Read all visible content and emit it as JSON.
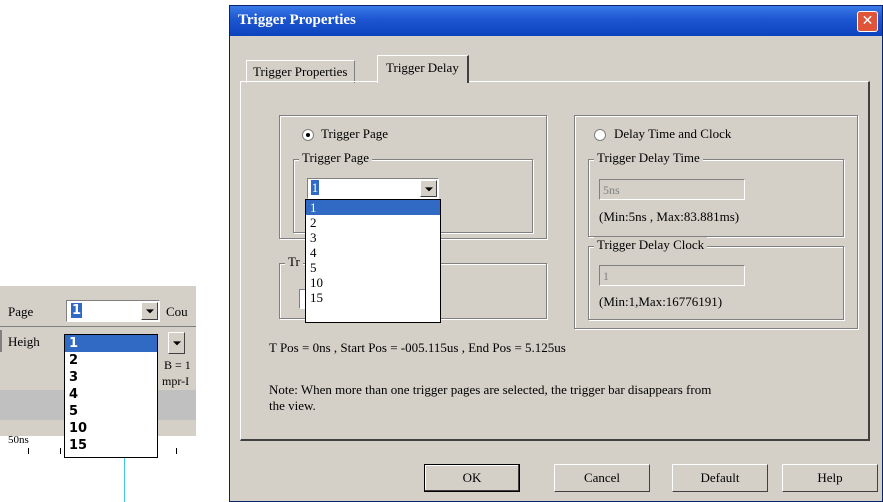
{
  "background_toolbar": {
    "page_label": "Page",
    "page_value": "1",
    "count_label": "Cou",
    "height_label": "Heigh",
    "b_text": "B = 1",
    "mpr_text": "mpr-I",
    "ruler_label": "50ns",
    "options": [
      "1",
      "2",
      "3",
      "4",
      "5",
      "10",
      "15"
    ],
    "selected": "1"
  },
  "dialog": {
    "title": "Trigger Properties",
    "close_symbol": "✕",
    "tabs": [
      {
        "label": "Trigger Properties",
        "active": false
      },
      {
        "label": "Trigger Delay",
        "active": true
      }
    ],
    "trigger_page_radio": {
      "label": "Trigger Page",
      "checked": true
    },
    "trigger_page_group": {
      "title": "Trigger Page",
      "selected_value": "1",
      "options": [
        "1",
        "2",
        "3",
        "4",
        "5",
        "10",
        "15"
      ]
    },
    "hidden_group_title_fragment": "Tr",
    "delay_radio": {
      "label": "Delay Time and Clock",
      "checked": false
    },
    "delay_time_group": {
      "title": "Trigger Delay Time",
      "value": "5ns",
      "range": "(Min:5ns , Max:83.881ms)"
    },
    "delay_clock_group": {
      "title": "Trigger Delay Clock",
      "value": "1",
      "range": "(Min:1,Max:16776191)"
    },
    "positions": "T Pos = 0ns , Start Pos = -005.115us , End Pos = 5.125us",
    "note_line1": "Note: When more than one trigger pages are selected, the trigger bar disappears from",
    "note_line2": "the view.",
    "buttons": {
      "ok": "OK",
      "cancel": "Cancel",
      "default": "Default",
      "help": "Help"
    }
  },
  "colors": {
    "title_bar": "#0b44bd",
    "selection": "#316ac5",
    "dialog_bg": "#d4d0c8",
    "close_button": "#e0553a"
  }
}
